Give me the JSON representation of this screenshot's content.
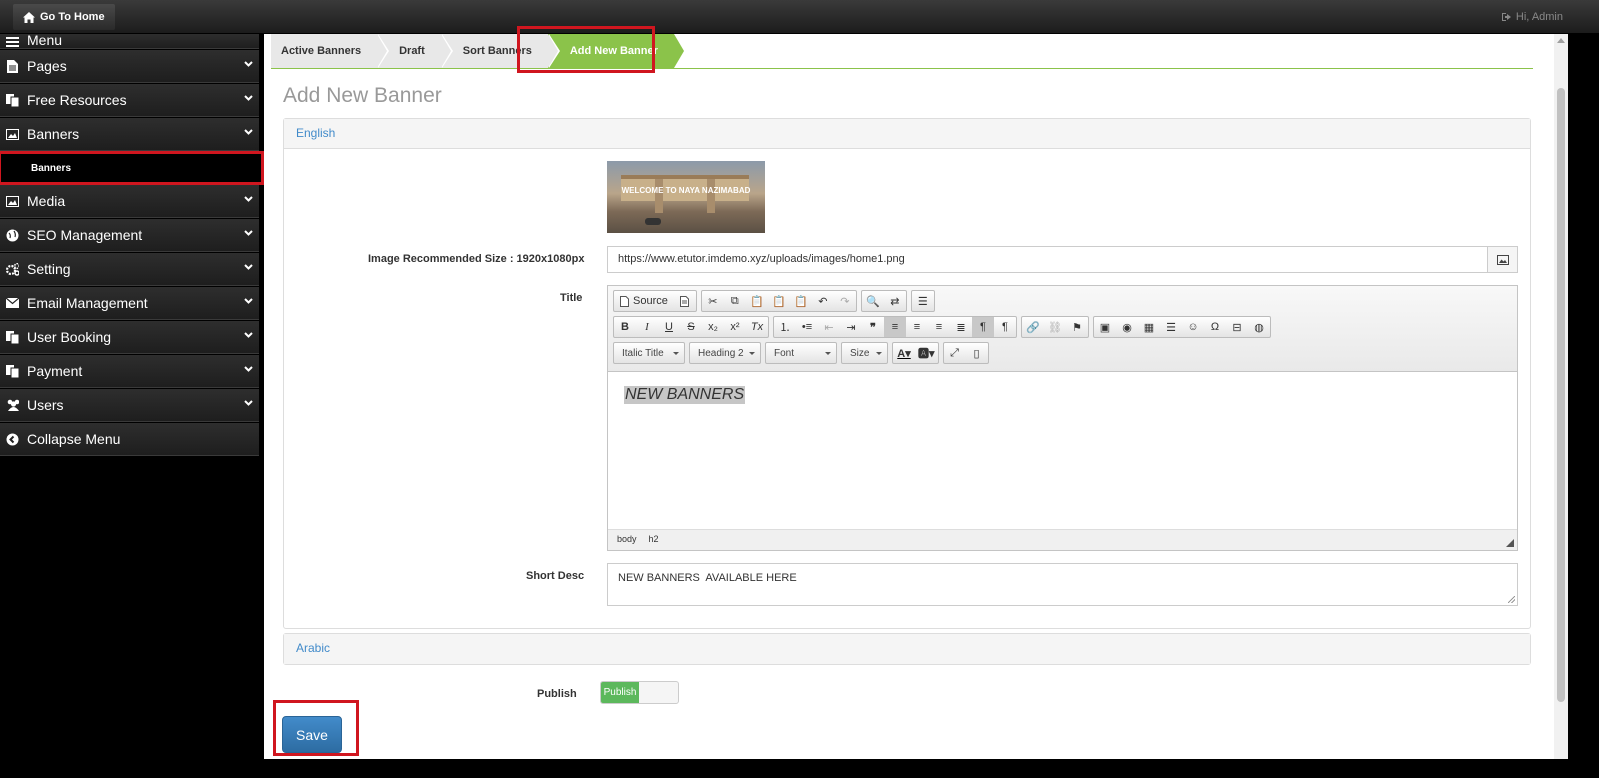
{
  "topbar": {
    "home_label": "Go To Home",
    "greeting": "Hi, Admin"
  },
  "sidebar": {
    "items": [
      {
        "label": "Menu",
        "icon": "menu-icon"
      },
      {
        "label": "Pages",
        "icon": "file-icon"
      },
      {
        "label": "Free Resources",
        "icon": "copy-icon"
      },
      {
        "label": "Banners",
        "icon": "picture-icon"
      },
      {
        "label": "Media",
        "icon": "picture-icon"
      },
      {
        "label": "SEO Management",
        "icon": "globe-icon"
      },
      {
        "label": "Setting",
        "icon": "gears-icon"
      },
      {
        "label": "Email Management",
        "icon": "envelope-icon"
      },
      {
        "label": "User Booking",
        "icon": "copy-icon"
      },
      {
        "label": "Payment",
        "icon": "copy-icon"
      },
      {
        "label": "Users",
        "icon": "users-icon"
      },
      {
        "label": "Collapse Menu",
        "icon": "chevron-circle-left-icon"
      }
    ],
    "sub_item": "Banners"
  },
  "breadcrumb": {
    "items": [
      "Active Banners",
      "Draft",
      "Sort Banners",
      "Add New Banner"
    ],
    "active": "Add New Banner"
  },
  "page": {
    "title": "Add New Banner"
  },
  "panels": {
    "english": "English",
    "arabic": "Arabic"
  },
  "form": {
    "image_label": "Image Recommended Size : 1920x1080px",
    "image_url": "https://www.etutor.imdemo.xyz/uploads/images/home1.png",
    "banner_text": "WELCOME TO NAYA NAZIMABAD",
    "title_label": "Title",
    "title_value": "NEW BANNERS",
    "short_desc_label": "Short Desc",
    "short_desc_value": "NEW BANNERS  AVAILABLE HERE",
    "publish_label": "Publish",
    "publish_toggle": "Publish",
    "save_label": "Save"
  },
  "editor": {
    "source_label": "Source",
    "combos": [
      "Italic Title",
      "Heading 2",
      "Font",
      "Size"
    ],
    "path": [
      "body",
      "h2"
    ]
  },
  "colors": {
    "accent_green": "#8bc34a",
    "highlight_red": "#d0161f",
    "primary_blue": "#428bca",
    "toggle_green": "#5cb85c"
  }
}
